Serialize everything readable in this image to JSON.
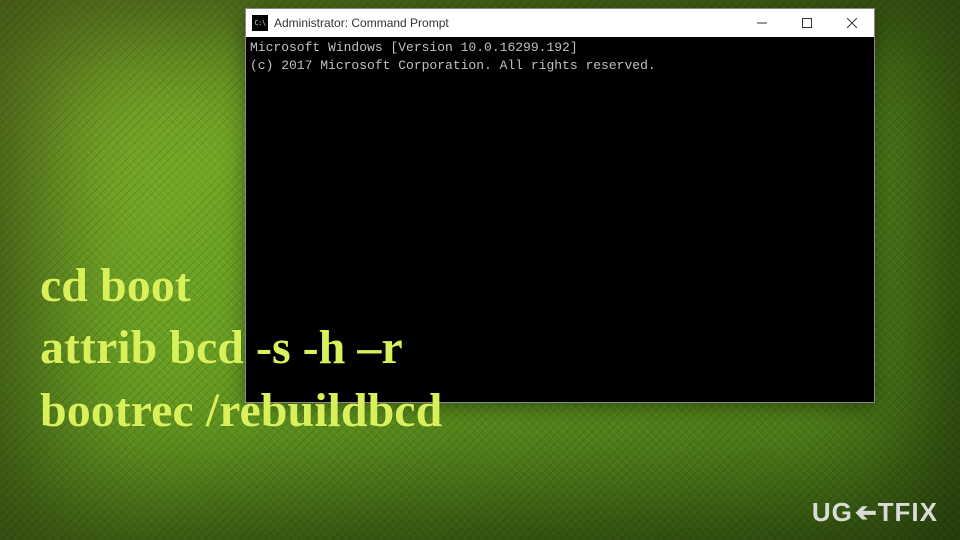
{
  "window": {
    "title": "Administrator: Command Prompt",
    "icon_label": "C:\\"
  },
  "console": {
    "line1": "Microsoft Windows [Version 10.0.16299.192]",
    "line2": "(c) 2017 Microsoft Corporation. All rights reserved."
  },
  "overlay": {
    "cmd1": "cd boot",
    "cmd2": "attrib bcd -s -h –r",
    "cmd3": "bootrec /rebuildbcd"
  },
  "watermark": {
    "part1": "UG",
    "part2": "TFIX"
  }
}
